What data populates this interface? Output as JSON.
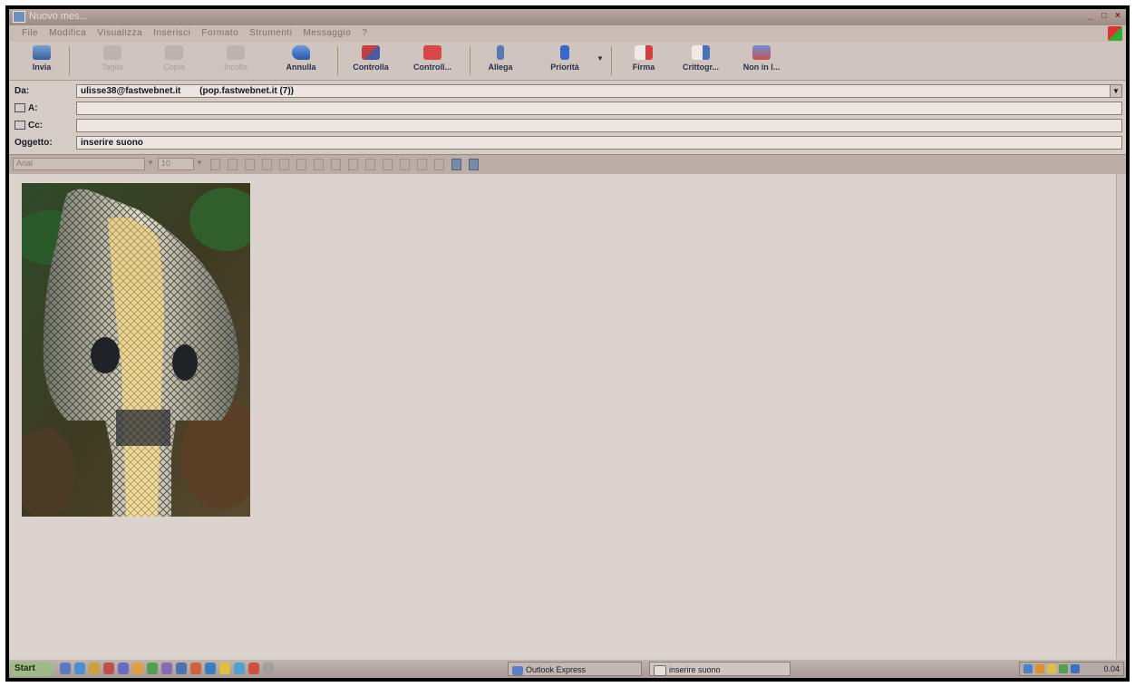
{
  "window": {
    "title": "Nuovo mes..."
  },
  "menubar": {
    "items": [
      "File",
      "Modifica",
      "Visualizza",
      "Inserisci",
      "Formato",
      "Strumenti",
      "Messaggio",
      "?"
    ]
  },
  "toolbar": {
    "buttons": [
      {
        "label": "Invia",
        "icon": "send-icon"
      },
      {
        "label": "Taglia",
        "icon": "scissors-icon"
      },
      {
        "label": "Copia",
        "icon": "copy-icon"
      },
      {
        "label": "Incolla",
        "icon": "paste-icon"
      },
      {
        "label": "Annulla",
        "icon": "undo-icon"
      },
      {
        "label": "Controlla",
        "icon": "check-names-icon"
      },
      {
        "label": "Controll...",
        "icon": "spellcheck-icon"
      },
      {
        "label": "Allega",
        "icon": "paperclip-icon"
      },
      {
        "label": "Priorità",
        "icon": "priority-icon"
      },
      {
        "label": "Firma",
        "icon": "sign-icon"
      },
      {
        "label": "Crittogr...",
        "icon": "encrypt-icon"
      },
      {
        "label": "Non in l...",
        "icon": "offline-icon"
      }
    ]
  },
  "header": {
    "from_label": "Da:",
    "from_value": "ulisse38@fastwebnet.it",
    "from_server": "(pop.fastwebnet.it (7))",
    "to_label": "A:",
    "to_value": "",
    "cc_label": "Cc:",
    "cc_value": "",
    "subject_label": "Oggetto:",
    "subject_value": "inserire suono"
  },
  "format": {
    "font": "Arial",
    "size": "10"
  },
  "taskbar": {
    "start_label": "Start",
    "tasks": [
      "Outlook Express",
      "inserire suono"
    ],
    "clock": "0.04"
  }
}
